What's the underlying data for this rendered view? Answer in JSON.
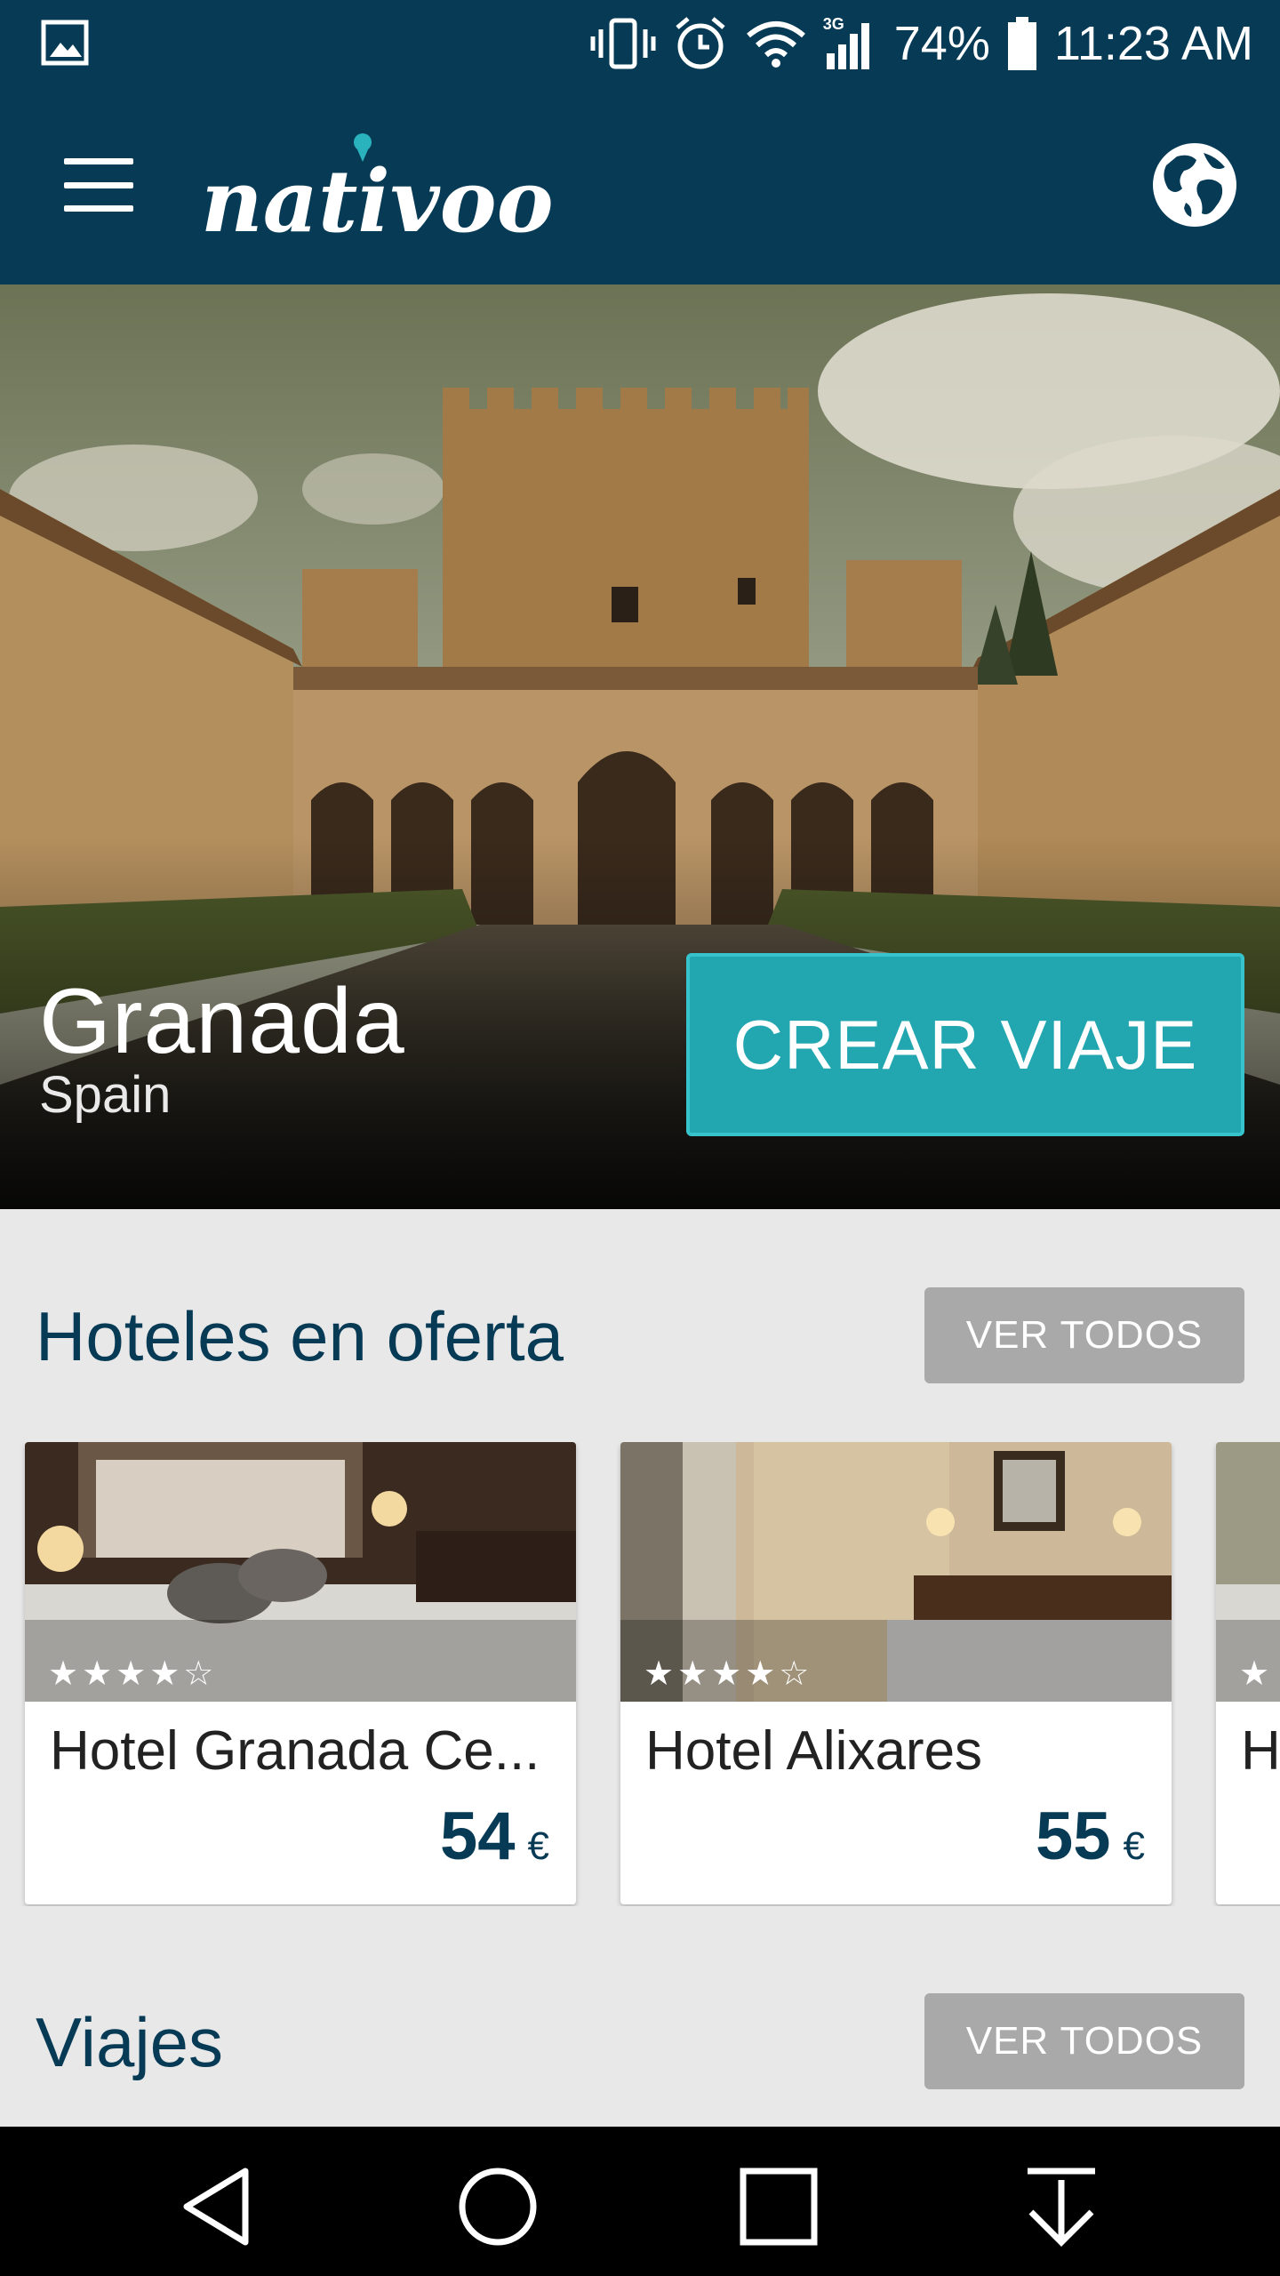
{
  "status_bar": {
    "battery": "74%",
    "time": "11:23 AM",
    "network": "3G",
    "icons": [
      "gallery-notification-icon",
      "vibrate-icon",
      "alarm-icon",
      "wifi-icon",
      "signal-icon",
      "battery-icon"
    ]
  },
  "app_bar": {
    "logo_text": "nativoo",
    "icons": [
      "menu-icon",
      "globe-icon"
    ]
  },
  "hero": {
    "city": "Granada",
    "country": "Spain",
    "cta_label": "CREAR VIAJE"
  },
  "hotels_section": {
    "title": "Hoteles en oferta",
    "see_all_label": "VER TODOS",
    "items": [
      {
        "name": "Hotel Granada Ce...",
        "price": "54",
        "currency": "€",
        "stars": 4,
        "stars_display": "★★★★☆"
      },
      {
        "name": "Hotel Alixares",
        "price": "55",
        "currency": "€",
        "stars": 4,
        "stars_display": "★★★★☆"
      },
      {
        "name": "H",
        "stars": 4,
        "stars_display": "★"
      }
    ]
  },
  "trips_section": {
    "title": "Viajes",
    "see_all_label": "VER TODOS"
  },
  "nav_bar": {
    "icons": [
      "back-icon",
      "home-icon",
      "recents-icon",
      "download-icon"
    ]
  },
  "colors": {
    "brand_dark": "#063a55",
    "cta": "#22a6b0",
    "button_gray": "#a9a9a9"
  }
}
